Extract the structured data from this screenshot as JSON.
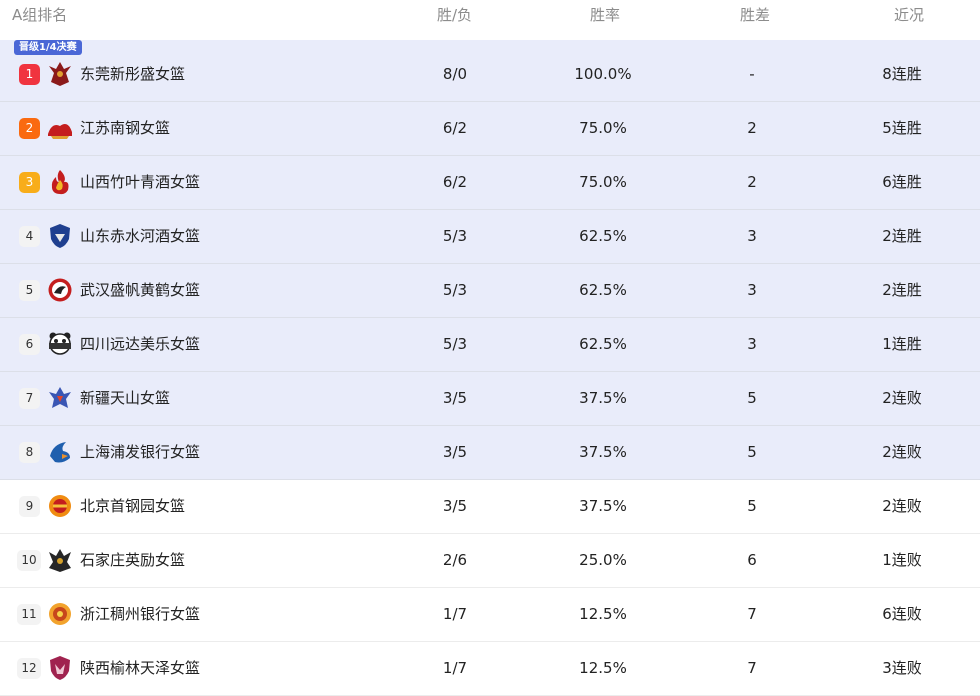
{
  "header": {
    "rank_label": "A组排名",
    "wl_label": "胜/负",
    "pct_label": "胜率",
    "diff_label": "胜差",
    "recent_label": "近况"
  },
  "qualification": {
    "label": "晋级1/4决赛"
  },
  "colors": {
    "qual_zone_bg": "#e9ecfa",
    "qual_badge": "#4a67d6",
    "rank1": "#f0343f",
    "rank2": "#fa6a10",
    "rank3": "#f8ad1a"
  },
  "rows": [
    {
      "rank": "1",
      "team": "东莞新彤盛女篮",
      "wl": "8/0",
      "pct": "100.0%",
      "diff": "-",
      "recent": "8连胜",
      "logo": "phoenix-logo-icon"
    },
    {
      "rank": "2",
      "team": "江苏南钢女篮",
      "wl": "6/2",
      "pct": "75.0%",
      "diff": "2",
      "recent": "5连胜",
      "logo": "dragon-logo-icon"
    },
    {
      "rank": "3",
      "team": "山西竹叶青酒女篮",
      "wl": "6/2",
      "pct": "75.0%",
      "diff": "2",
      "recent": "6连胜",
      "logo": "flame-logo-icon"
    },
    {
      "rank": "4",
      "team": "山东赤水河酒女篮",
      "wl": "5/3",
      "pct": "62.5%",
      "diff": "3",
      "recent": "2连胜",
      "logo": "shield-logo-icon"
    },
    {
      "rank": "5",
      "team": "武汉盛帆黄鹤女篮",
      "wl": "5/3",
      "pct": "62.5%",
      "diff": "3",
      "recent": "2连胜",
      "logo": "crane-logo-icon"
    },
    {
      "rank": "6",
      "team": "四川远达美乐女篮",
      "wl": "5/3",
      "pct": "62.5%",
      "diff": "3",
      "recent": "1连胜",
      "logo": "panda-logo-icon"
    },
    {
      "rank": "7",
      "team": "新疆天山女篮",
      "wl": "3/5",
      "pct": "37.5%",
      "diff": "5",
      "recent": "2连败",
      "logo": "eagle-logo-icon"
    },
    {
      "rank": "8",
      "team": "上海浦发银行女篮",
      "wl": "3/5",
      "pct": "37.5%",
      "diff": "5",
      "recent": "2连败",
      "logo": "shark-logo-icon"
    },
    {
      "rank": "9",
      "team": "北京首钢园女篮",
      "wl": "3/5",
      "pct": "37.5%",
      "diff": "5",
      "recent": "2连败",
      "logo": "ducks-logo-icon"
    },
    {
      "rank": "10",
      "team": "石家庄英励女篮",
      "wl": "2/6",
      "pct": "25.0%",
      "diff": "6",
      "recent": "1连败",
      "logo": "horse-logo-icon"
    },
    {
      "rank": "11",
      "team": "浙江稠州银行女篮",
      "wl": "1/7",
      "pct": "12.5%",
      "diff": "7",
      "recent": "6连败",
      "logo": "lion-logo-icon"
    },
    {
      "rank": "12",
      "team": "陕西榆林天泽女篮",
      "wl": "1/7",
      "pct": "12.5%",
      "diff": "7",
      "recent": "3连败",
      "logo": "wolf-logo-icon"
    }
  ]
}
